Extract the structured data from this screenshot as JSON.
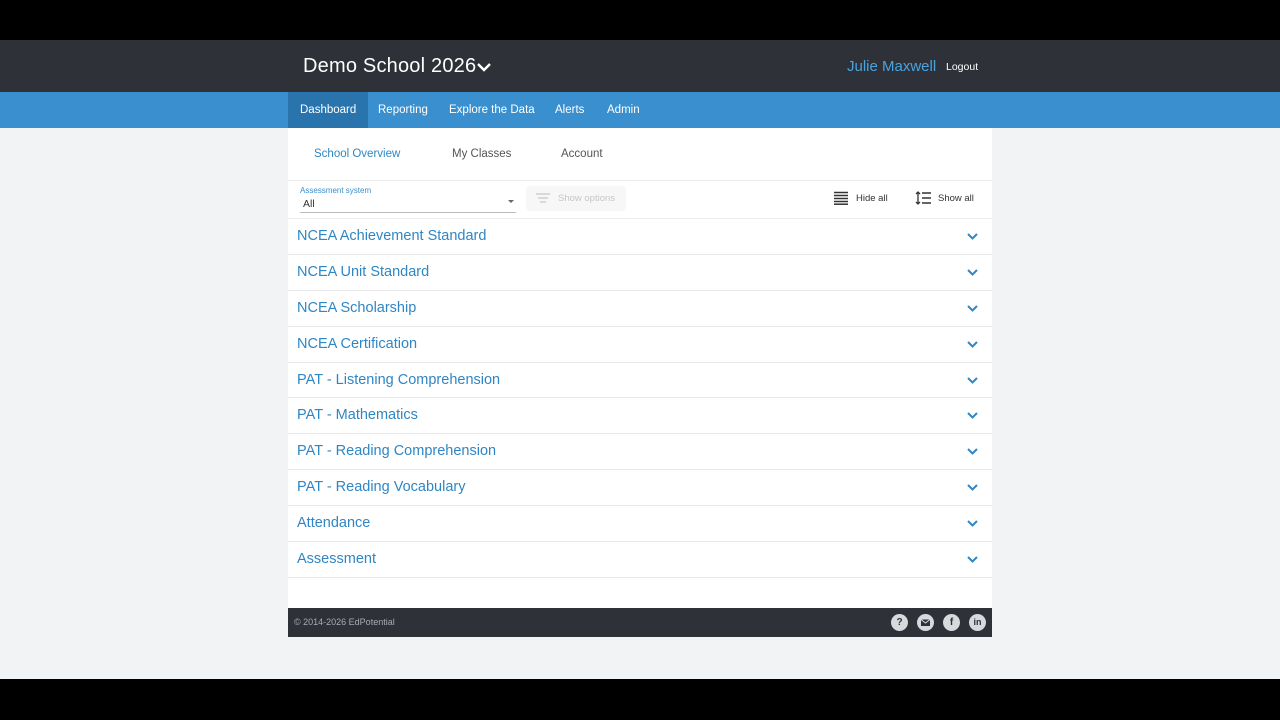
{
  "header": {
    "school_name": "Demo School 2026",
    "user_name": "Julie Maxwell",
    "logout_label": "Logout"
  },
  "nav": {
    "items": [
      {
        "label": "Dashboard",
        "active": true
      },
      {
        "label": "Reporting",
        "active": false
      },
      {
        "label": "Explore the Data",
        "active": false
      },
      {
        "label": "Alerts",
        "active": false
      },
      {
        "label": "Admin",
        "active": false
      }
    ]
  },
  "subtabs": [
    {
      "label": "School Overview",
      "active": true
    },
    {
      "label": "My Classes",
      "active": false
    },
    {
      "label": "Account",
      "active": false
    }
  ],
  "filters": {
    "assessment_label": "Assessment system",
    "assessment_value": "All",
    "show_options_label": "Show options",
    "hide_all_label": "Hide all",
    "show_all_label": "Show all"
  },
  "sections": [
    "NCEA Achievement Standard",
    "NCEA Unit Standard",
    "NCEA Scholarship",
    "NCEA Certification",
    "PAT - Listening Comprehension",
    "PAT - Mathematics",
    "PAT - Reading Comprehension",
    "PAT - Reading Vocabulary",
    "Attendance",
    "Assessment"
  ],
  "footer": {
    "copyright": "© 2014-2026 EdPotential",
    "icons": [
      "help-icon",
      "email-icon",
      "facebook-icon",
      "linkedin-icon"
    ]
  },
  "colors": {
    "accent": "#3a8fce",
    "link": "#2f86c4",
    "dark": "#2e3138"
  }
}
